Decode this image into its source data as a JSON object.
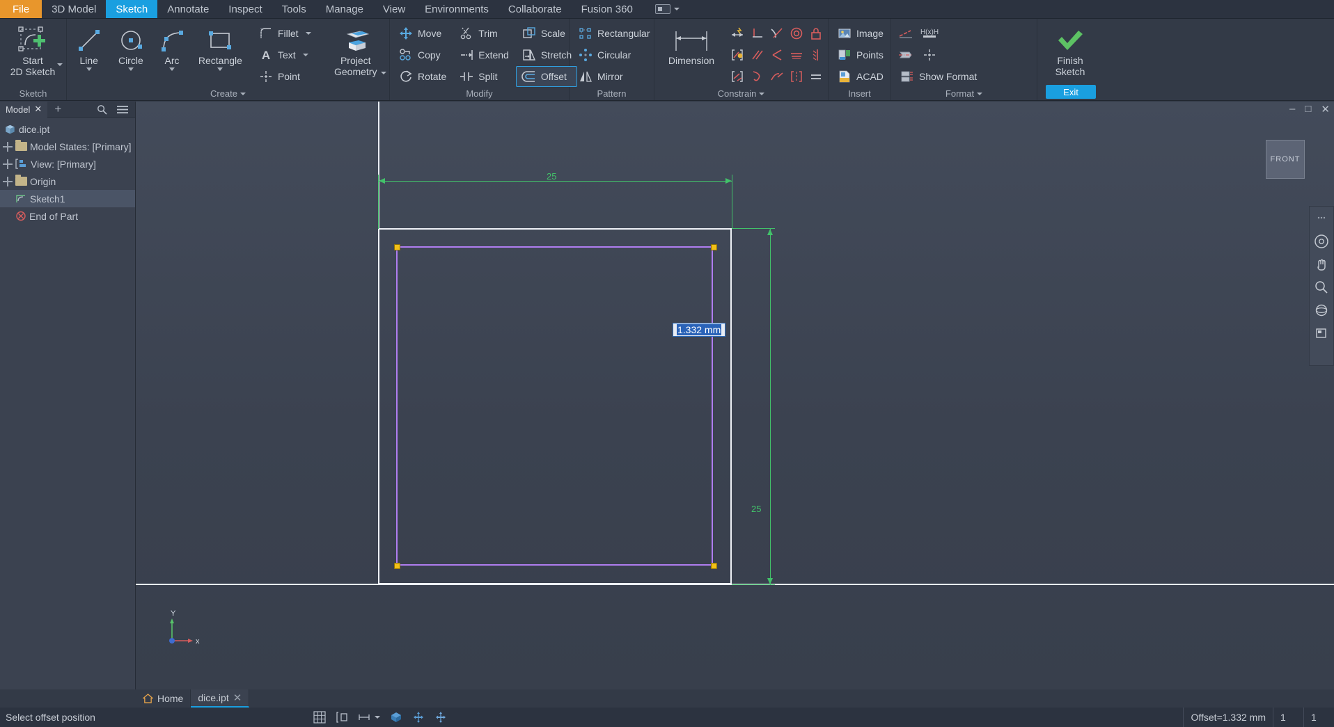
{
  "menu": {
    "file_label": "File",
    "items": [
      {
        "label": "3D Model",
        "active": false
      },
      {
        "label": "Sketch",
        "active": true
      },
      {
        "label": "Annotate",
        "active": false
      },
      {
        "label": "Inspect",
        "active": false
      },
      {
        "label": "Tools",
        "active": false
      },
      {
        "label": "Manage",
        "active": false
      },
      {
        "label": "View",
        "active": false
      },
      {
        "label": "Environments",
        "active": false
      },
      {
        "label": "Collaborate",
        "active": false
      },
      {
        "label": "Fusion 360",
        "active": false
      }
    ]
  },
  "ribbon": {
    "panels": [
      {
        "title": "Sketch",
        "big": [
          {
            "label_line1": "Start",
            "label_line2": "2D Sketch",
            "icon": "start-2d-sketch-icon",
            "has_caret": true
          }
        ]
      },
      {
        "title": "Create",
        "has_caret": true,
        "big": [
          {
            "label_line1": "Line",
            "label_line2": "",
            "icon": "line-icon",
            "has_caret": true
          },
          {
            "label_line1": "Circle",
            "label_line2": "",
            "icon": "circle-icon",
            "has_caret": true
          },
          {
            "label_line1": "Arc",
            "label_line2": "",
            "icon": "arc-icon",
            "has_caret": true
          },
          {
            "label_line1": "Rectangle",
            "label_line2": "",
            "icon": "rectangle-icon",
            "has_caret": true
          }
        ],
        "small": [
          {
            "label": "Fillet",
            "icon": "fillet-icon",
            "has_caret": true
          },
          {
            "label": "Text",
            "icon": "text-icon",
            "has_caret": true
          },
          {
            "label": "Point",
            "icon": "point-icon",
            "has_caret": false
          }
        ],
        "big2": [
          {
            "label_line1": "Project",
            "label_line2": "Geometry",
            "icon": "project-geometry-icon",
            "has_caret": true
          }
        ]
      },
      {
        "title": "Modify",
        "small_cols": [
          [
            {
              "label": "Move",
              "icon": "move-icon",
              "active": false
            },
            {
              "label": "Copy",
              "icon": "copy-icon",
              "active": false
            },
            {
              "label": "Rotate",
              "icon": "rotate-icon",
              "active": false
            }
          ],
          [
            {
              "label": "Trim",
              "icon": "trim-icon",
              "active": false
            },
            {
              "label": "Extend",
              "icon": "extend-icon",
              "active": false
            },
            {
              "label": "Split",
              "icon": "split-icon",
              "active": false
            }
          ],
          [
            {
              "label": "Scale",
              "icon": "scale-icon",
              "active": false
            },
            {
              "label": "Stretch",
              "icon": "stretch-icon",
              "active": false
            },
            {
              "label": "Offset",
              "icon": "offset-icon",
              "active": true
            }
          ]
        ]
      },
      {
        "title": "Pattern",
        "small_cols": [
          [
            {
              "label": "Rectangular",
              "icon": "rectangular-pattern-icon",
              "active": false
            },
            {
              "label": "Circular",
              "icon": "circular-pattern-icon",
              "active": false
            },
            {
              "label": "Mirror",
              "icon": "mirror-icon",
              "active": false
            }
          ]
        ]
      },
      {
        "title": "Constrain",
        "has_caret": true,
        "big": [
          {
            "label_line1": "Dimension",
            "label_line2": "",
            "icon": "dimension-icon",
            "has_caret": false
          }
        ],
        "grid_icons": [
          "auto-dimension-icon",
          "perpendicular-constraint-icon",
          "tangent-constraint-icon",
          "concentric-constraint-icon",
          "fix-constraint-icon",
          "show-constraints-icon",
          "parallel-constraint-icon",
          "coincident-constraint-icon",
          "collinear-constraint-icon",
          "vertical-constraint-icon",
          "constraint-settings-icon",
          "smooth-constraint-icon",
          "horizontal-constraint-icon",
          "symmetric-constraint-icon",
          "equal-constraint-icon"
        ]
      },
      {
        "title": "Insert",
        "small_cols": [
          [
            {
              "label": "Image",
              "icon": "image-icon",
              "active": false
            },
            {
              "label": "Points",
              "icon": "points-icon",
              "active": false
            },
            {
              "label": "ACAD",
              "icon": "acad-icon",
              "active": false
            }
          ]
        ]
      },
      {
        "title": "Format",
        "has_caret": true,
        "grid_icons2": [
          "construction-line-icon",
          "driven-dimension-icon",
          "centerline-icon",
          "center-point-icon"
        ],
        "small_cols": [
          [
            {
              "label": "Show Format",
              "icon": "show-format-icon",
              "active": false
            }
          ]
        ]
      },
      {
        "title": "Exit",
        "title_active": true,
        "big": [
          {
            "label_line1": "Finish",
            "label_line2": "Sketch",
            "icon": "finish-sketch-icon",
            "has_caret": false
          }
        ]
      }
    ]
  },
  "browser": {
    "tab_label": "Model",
    "close_icon": "close-icon",
    "add_icon": "add-icon",
    "search_icon": "search-icon",
    "menu_icon": "hamburger-menu-icon",
    "tree": [
      {
        "label": "dice.ipt",
        "indent": 0,
        "expander": false,
        "icon": "part-icon",
        "selected": false
      },
      {
        "label": "Model States: [Primary]",
        "indent": 1,
        "expander": true,
        "icon": "folder-icon",
        "selected": false
      },
      {
        "label": "View: [Primary]",
        "indent": 1,
        "expander": true,
        "icon": "view-icon",
        "selected": false
      },
      {
        "label": "Origin",
        "indent": 1,
        "expander": true,
        "icon": "folder-icon",
        "selected": false
      },
      {
        "label": "Sketch1",
        "indent": 1,
        "expander": false,
        "icon": "sketch-icon",
        "selected": true
      },
      {
        "label": "End of Part",
        "indent": 1,
        "expander": false,
        "icon": "end-of-part-icon",
        "selected": false
      }
    ]
  },
  "canvas": {
    "viewcube_label": "FRONT",
    "offset_value_field": "1.332 mm",
    "dimension_horizontal": "25",
    "dimension_vertical": "25",
    "axis_x_label": "x",
    "axis_y_label": "Y"
  },
  "doctabs": [
    {
      "label": "Home",
      "icon": "home-icon",
      "active": false,
      "closable": false
    },
    {
      "label": "dice.ipt",
      "icon": "",
      "active": true,
      "closable": true
    }
  ],
  "statusbar": {
    "message": "Select offset position",
    "offset_readout": "Offset=1.332 mm",
    "count_1": "1",
    "count_2": "1",
    "tool_icons": [
      "grid-snap-icon",
      "measure-icon",
      "dimension-display-icon",
      "slice-graphics-icon",
      "constraint-icon",
      "move-icon-status"
    ]
  },
  "colors": {
    "accent_blue": "#1a9fe0",
    "file_orange": "#e8962c",
    "offset_purple": "#b07df0",
    "dimension_green": "#42c26a",
    "node_yellow": "#f2c018",
    "finish_green": "#5dc264"
  }
}
